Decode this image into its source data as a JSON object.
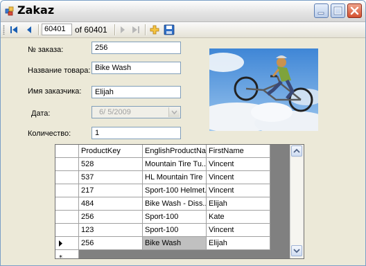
{
  "window": {
    "title": "Zakaz"
  },
  "navigator": {
    "position": "60401",
    "of_label": "of 60401"
  },
  "form": {
    "order_label": "№ заказа:",
    "order_value": "256",
    "product_label": "Название товара:",
    "product_value": "Bike Wash",
    "customer_label": "Имя заказчика:",
    "customer_value": "Elijah",
    "date_label": "Дата:",
    "date_value": "6/ 5/2009",
    "qty_label": "Количество:",
    "qty_value": "1"
  },
  "photo": {
    "subject": "bmx-rider-in-sky"
  },
  "grid": {
    "columns": [
      "ProductKey",
      "EnglishProductName",
      "FirstName"
    ],
    "rows": [
      [
        "528",
        "Mountain Tire Tu...",
        "Vincent"
      ],
      [
        "537",
        "HL Mountain Tire",
        "Vincent"
      ],
      [
        "217",
        "Sport-100 Helmet...",
        "Vincent"
      ],
      [
        "484",
        "Bike Wash - Diss...",
        "Elijah"
      ],
      [
        "256",
        "Sport-100",
        "Kate"
      ],
      [
        "123",
        "Sport-100",
        "Vincent"
      ],
      [
        "256",
        "Bike Wash",
        "Elijah"
      ]
    ],
    "current_row": 6
  },
  "colors": {
    "title_bg": "#e3e3e3",
    "window_bg": "#ece9d8",
    "grid_bg": "#808080",
    "selection": "#c0c0c0",
    "accent": "#1a5fb4"
  }
}
